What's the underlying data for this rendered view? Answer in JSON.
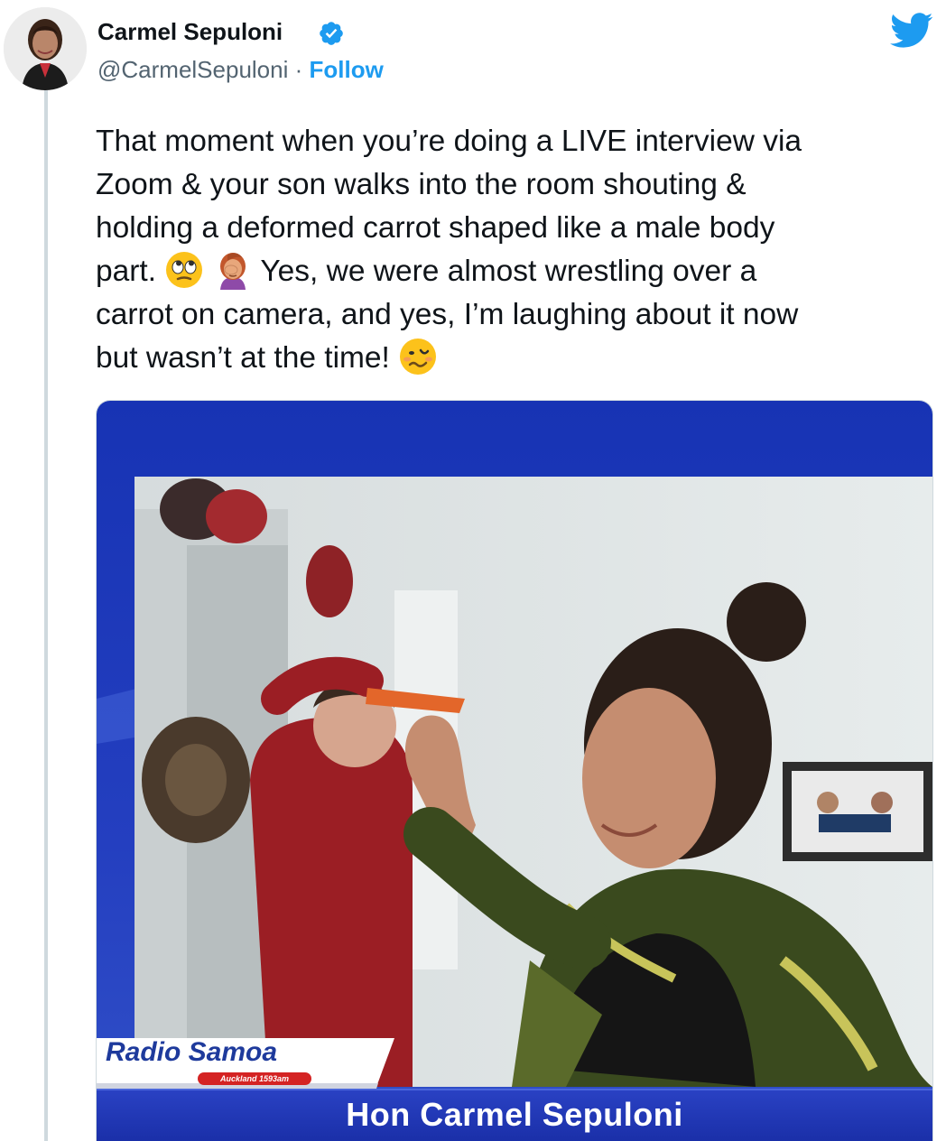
{
  "author": {
    "name": "Carmel Sepuloni",
    "handle": "@CarmelSepuloni",
    "separator": "·",
    "follow_label": "Follow"
  },
  "icons": {
    "verified": "verified-badge-icon",
    "brand": "twitter-bird-icon",
    "emoji_1": "face-with-rolling-eyes",
    "emoji_2": "woman-facepalming",
    "emoji_3": "woozy-face"
  },
  "tweet": {
    "line1": "That moment when you’re doing a LIVE interview via",
    "line2": "Zoom & your son walks into the room shouting &",
    "line3": "holding a deformed carrot shaped like a male body",
    "line4_a": "part.",
    "line4_b": "Yes, we were almost wrestling over a",
    "line5": "carrot on camera, and yes, I’m laughing about it now",
    "line6": "but wasn’t at the time!"
  },
  "media": {
    "station_name": "Radio Samoa",
    "station_sub": "Auckland 1593am",
    "caption": "Hon Carmel Sepuloni"
  },
  "colors": {
    "brand_blue": "#1d9bf0",
    "text": "#0f1419",
    "secondary": "#536471",
    "broadcast_blue": "#1a2fa8"
  }
}
